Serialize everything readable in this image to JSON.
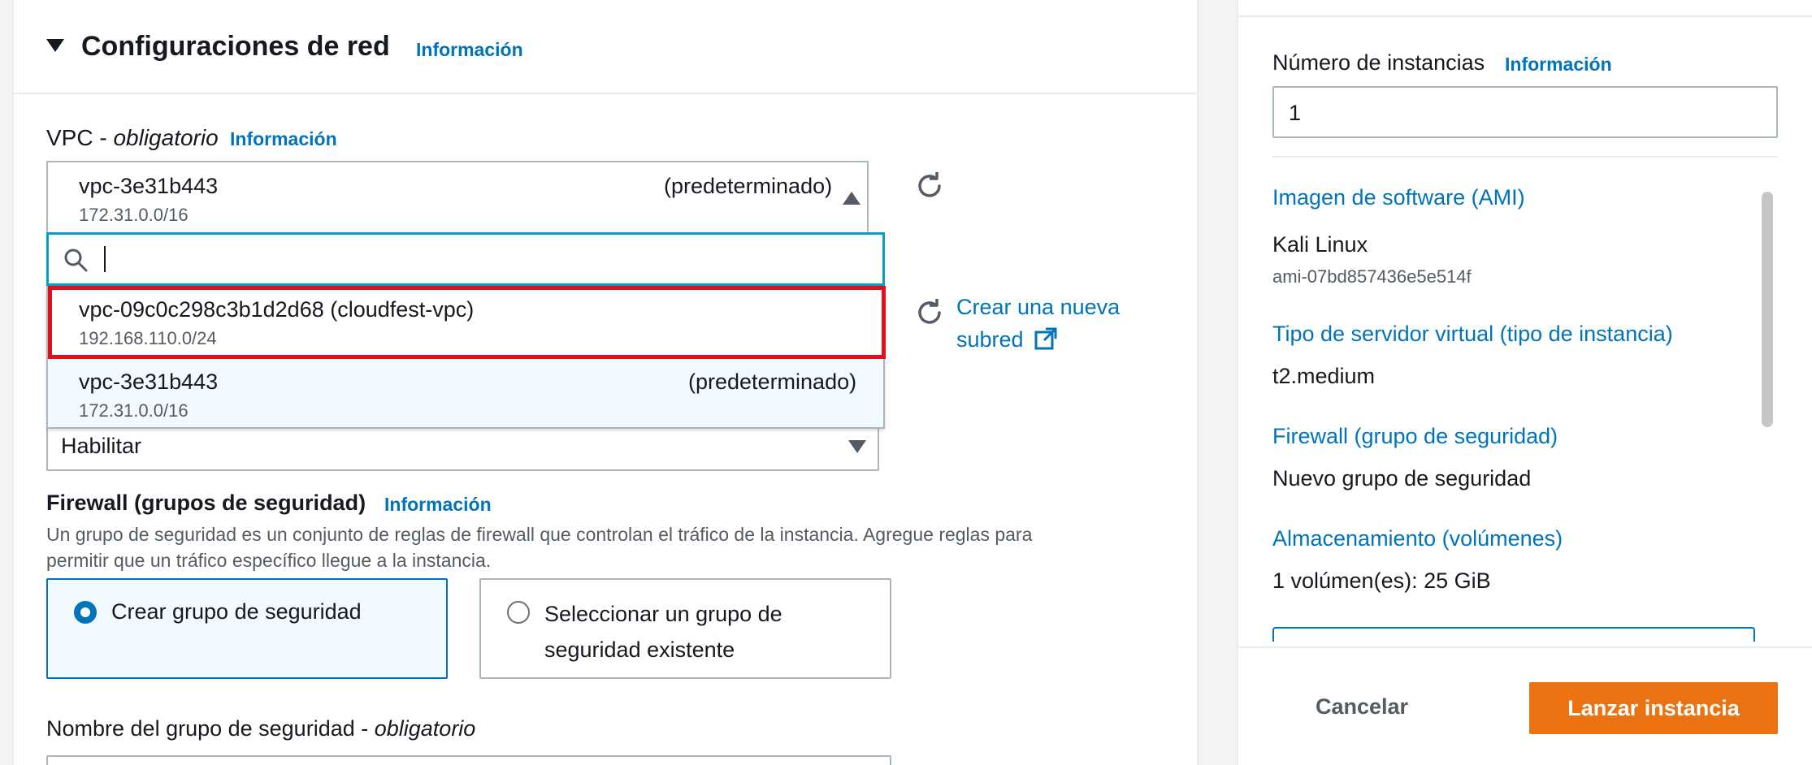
{
  "network": {
    "title": "Configuraciones de red",
    "info": "Información",
    "vpc_label": "VPC - ",
    "vpc_required": "obligatorio",
    "vpc_info": "Información",
    "selected_vpc": {
      "id": "vpc-3e31b443",
      "tag": "(predeterminado)",
      "cidr": "172.31.0.0/16"
    },
    "search_placeholder": "",
    "options": [
      {
        "id": "vpc-09c0c298c3b1d2d68 (cloudfest-vpc)",
        "tag": "",
        "cidr": "192.168.110.0/24"
      },
      {
        "id": "vpc-3e31b443",
        "tag": "(predeterminado)",
        "cidr": "172.31.0.0/16"
      }
    ],
    "create_subnet_line1": "Crear una nueva",
    "create_subnet_line2": "subred",
    "public_ip_value": "Habilitar"
  },
  "firewall": {
    "label": "Firewall (grupos de seguridad)",
    "info": "Información",
    "description_line1": "Un grupo de seguridad es un conjunto de reglas de firewall que controlan el tráfico de la instancia. Agregue reglas para",
    "description_line2": "permitir que un tráfico específico llegue a la instancia.",
    "option_create": "Crear grupo de seguridad",
    "option_existing_line1": "Seleccionar un grupo de",
    "option_existing_line2": "seguridad existente",
    "sg_name_label": "Nombre del grupo de seguridad - ",
    "sg_name_required": "obligatorio"
  },
  "summary": {
    "instances_label": "Número de instancias",
    "instances_info": "Información",
    "instances_value": "1",
    "ami_label": "Imagen de software (AMI)",
    "ami_value": "Kali Linux",
    "ami_id": "ami-07bd857436e5e514f",
    "type_label": "Tipo de servidor virtual (tipo de instancia)",
    "type_value": "t2.medium",
    "firewall_label": "Firewall (grupo de seguridad)",
    "firewall_value": "Nuevo grupo de seguridad",
    "storage_label": "Almacenamiento (volúmenes)",
    "storage_value": "1 volúmen(es): 25 GiB"
  },
  "actions": {
    "cancel": "Cancelar",
    "launch": "Lanzar instancia"
  },
  "colors": {
    "accent": "#0073bb",
    "primary_button": "#ec7211",
    "highlight": "#e0101b"
  }
}
